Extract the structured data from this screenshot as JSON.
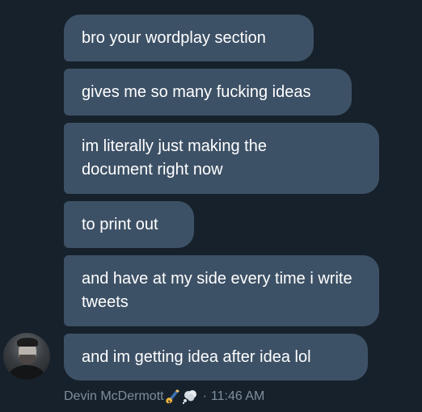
{
  "messages": [
    {
      "text": "bro your wordplay section"
    },
    {
      "text": "gives me so many fucking ideas"
    },
    {
      "text": "im literally just making the document right now"
    },
    {
      "text": "to print out"
    },
    {
      "text": "and have at my side every time i write tweets"
    },
    {
      "text": "and im getting idea after idea lol"
    }
  ],
  "meta": {
    "sender": "Devin McDermott",
    "separator": "·",
    "time": "11:46 AM"
  },
  "icons": {
    "status_emoji_1": "writing-hand-icon",
    "status_emoji_2": "thought-balloon-icon"
  },
  "colors": {
    "background": "#17212b",
    "bubble": "#3d5166",
    "meta_text": "#7f8e9c"
  }
}
